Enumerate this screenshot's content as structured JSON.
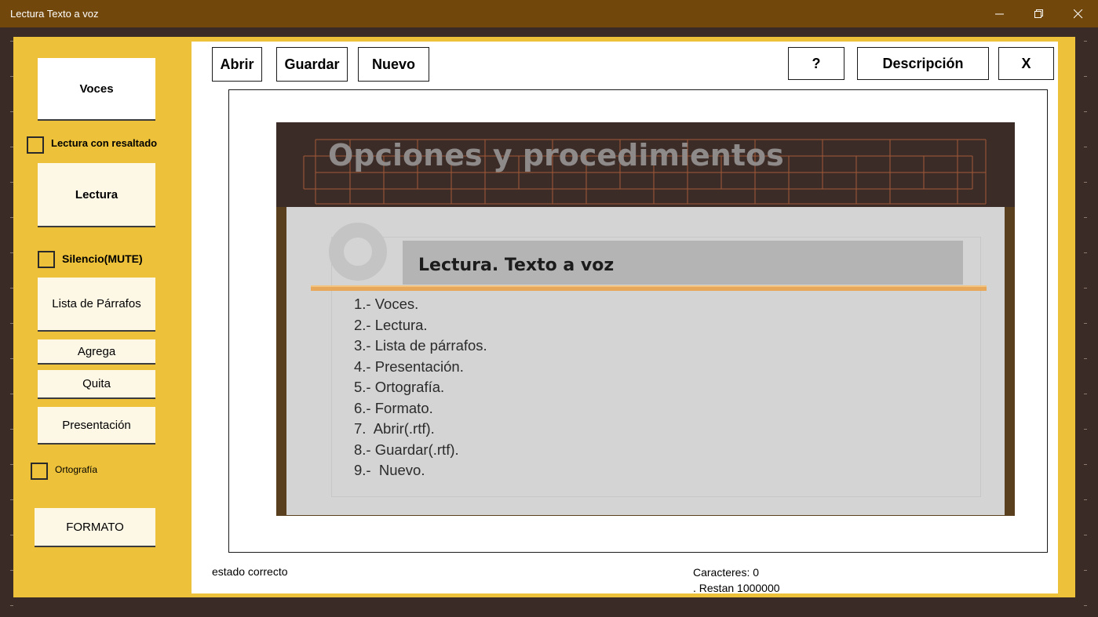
{
  "window": {
    "title": "Lectura Texto a voz",
    "title_color": "#71470b",
    "frame_color": "#edc23a",
    "controls": [
      "minimize-icon",
      "restore-icon",
      "close-icon"
    ]
  },
  "sidebar": {
    "voces_label": "Voces",
    "lectura_resaltado_label": "Lectura con resaltado",
    "lectura_resaltado_checked": false,
    "lectura_label": "Lectura",
    "silencio_label": "Silencio(MUTE)",
    "silencio_checked": false,
    "lista_label": "Lista de Párrafos",
    "agrega_label": "Agrega",
    "quita_label": "Quita",
    "presentacion_label": "Presentación",
    "ortografia_label": "Ortografía",
    "ortografia_checked": false,
    "formato_label": "FORMATO"
  },
  "toolbar": {
    "abrir_label": "Abrir",
    "guardar_label": "Guardar",
    "nuevo_label": "Nuevo",
    "help_label": "?",
    "descripcion_label": "Descripción",
    "close_label": "X"
  },
  "slide": {
    "title": "Opciones y procedimientos",
    "subtitle": "Lectura. Texto a voz",
    "items": [
      "1.- Voces.",
      "2.- Lectura.",
      "3.- Lista de párrafos.",
      "4.- Presentación.",
      "5.- Ortografía.",
      "6.- Formato.",
      "7.  Abrir(.rtf).",
      "8.- Guardar(.rtf).",
      "9.-  Nuevo."
    ]
  },
  "status": {
    "state": "estado correcto",
    "characters": "Caracteres: 0",
    "remaining": ". Restan 1000000"
  }
}
